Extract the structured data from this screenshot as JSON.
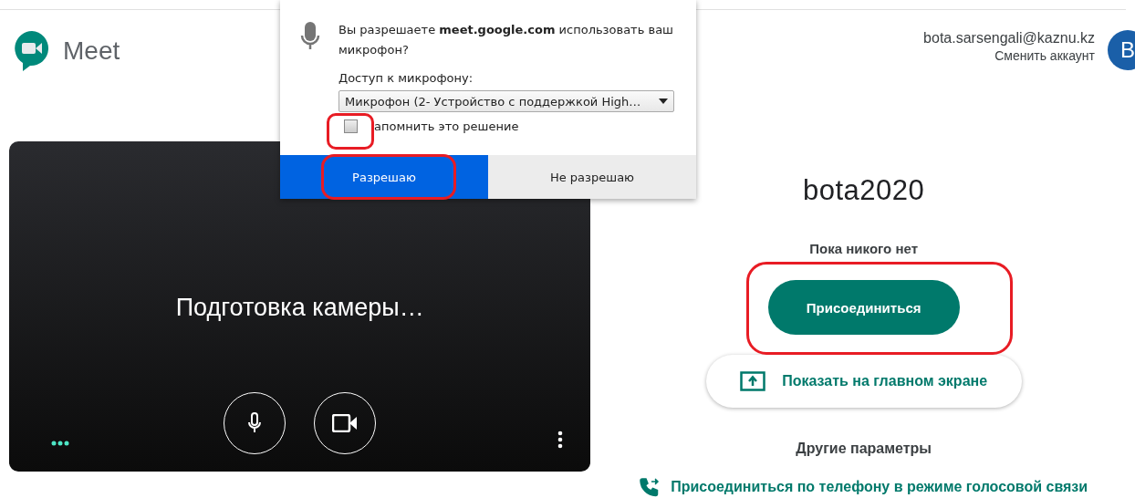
{
  "header": {
    "product_name": "Meet",
    "account": {
      "email": "bota.sarsengali@kaznu.kz",
      "switch_link": "Сменить аккаунт",
      "avatar_letter": "B"
    }
  },
  "preview": {
    "status": "Подготовка камеры…",
    "controls": [
      {
        "kind": "mic"
      },
      {
        "kind": "camera"
      }
    ]
  },
  "meeting": {
    "title": "bota2020",
    "participants_note": "Пока никого нет",
    "join_button": "Присоединиться",
    "present_button": "Показать на главном экране",
    "other_options": "Другие параметры",
    "phone_link": "Присоединиться по телефону в режиме голосовой связи"
  },
  "permission_dialog": {
    "question": "Вы разрешаете **meet.google.com** использовать ваш микрофон?",
    "device_label": "Доступ к микрофону:",
    "device_select": {
      "value": "Микрофон (2- Устройство с поддержкой High…"
    },
    "remember": {
      "label": "апомнить это решение",
      "checked": false
    },
    "buttons": [
      {
        "label": "Разрешаю",
        "selected": true
      },
      {
        "label": "Не разрешаю",
        "selected": false
      }
    ]
  }
}
